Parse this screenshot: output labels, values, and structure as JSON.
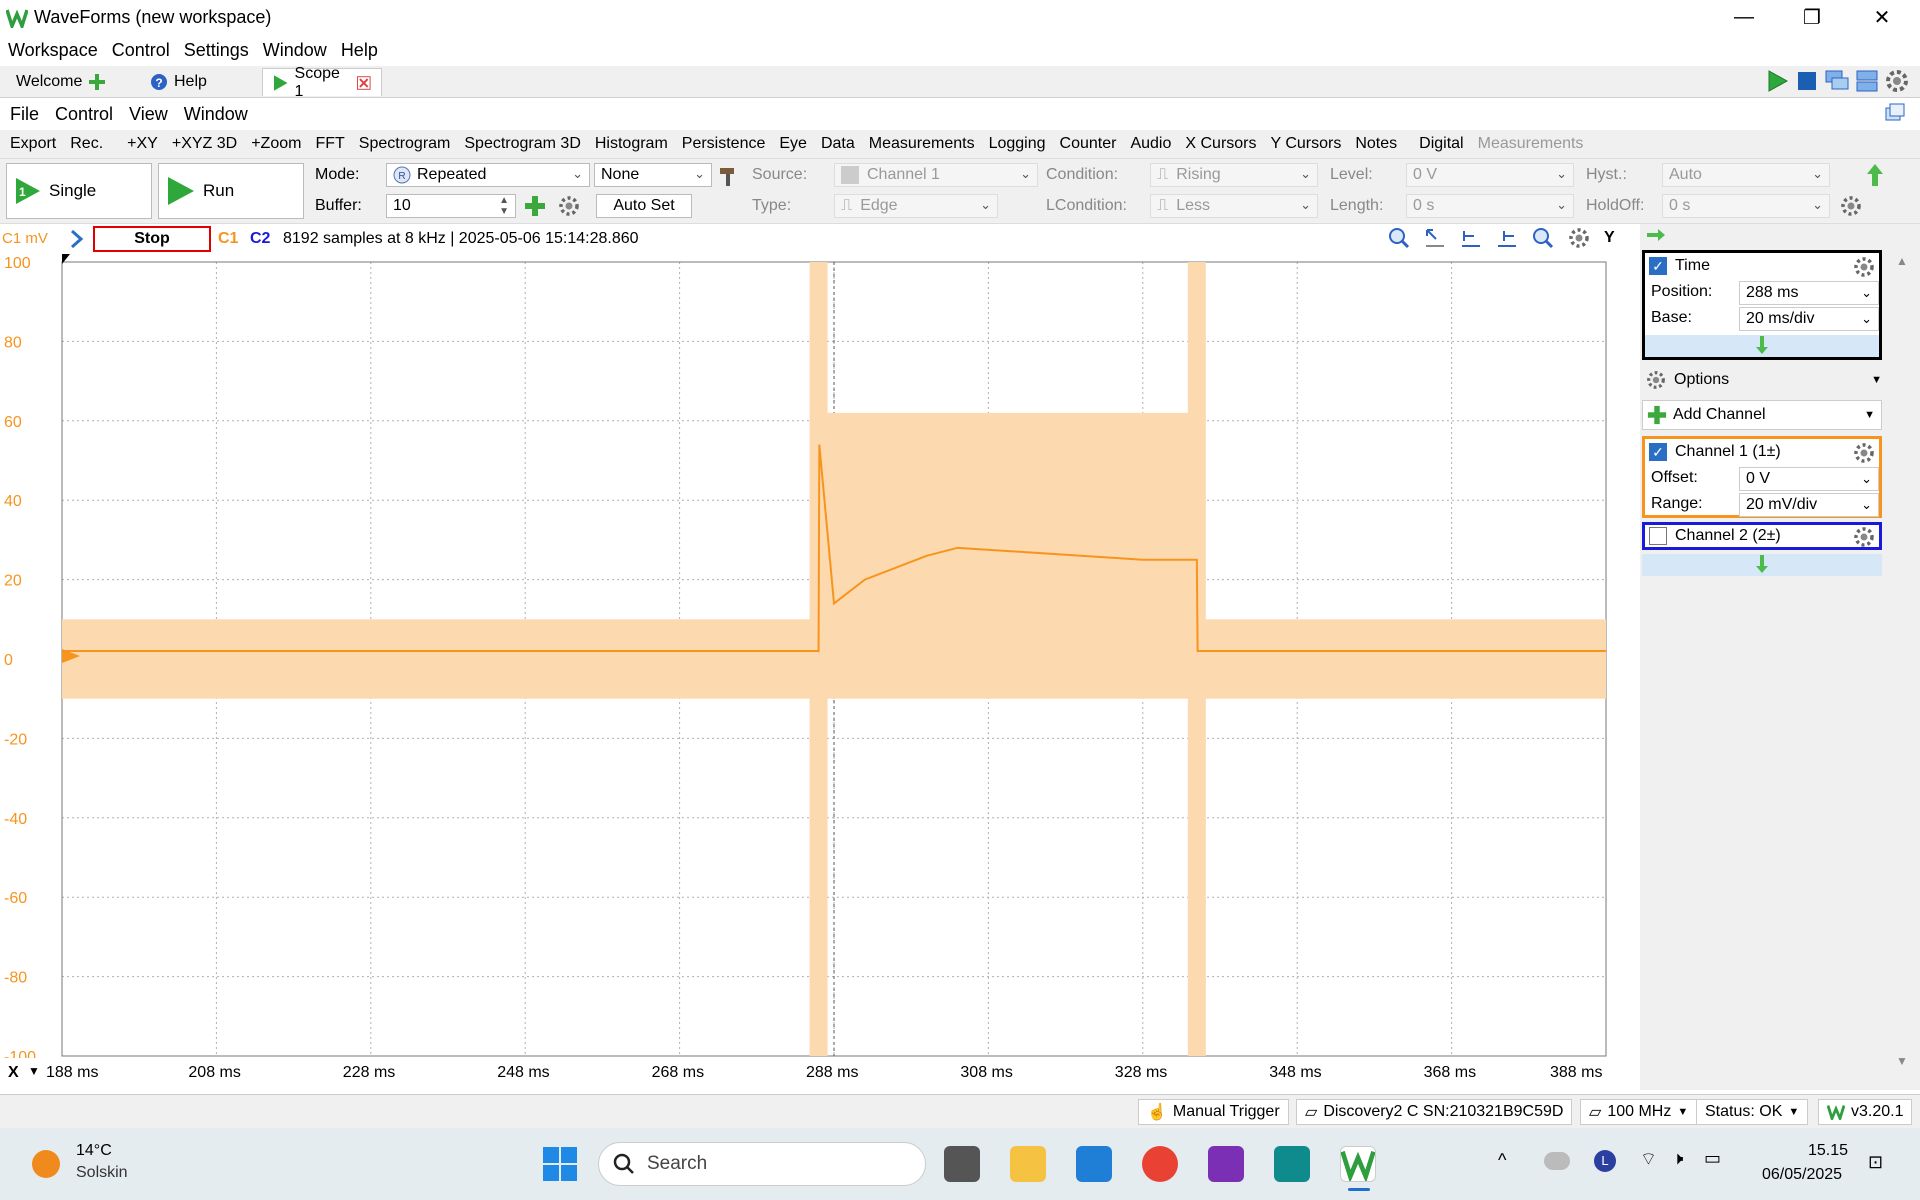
{
  "window": {
    "title": "WaveForms (new workspace)",
    "minimize": "—",
    "maximize": "❐",
    "close": "✕"
  },
  "menu": [
    "Workspace",
    "Control",
    "Settings",
    "Window",
    "Help"
  ],
  "tabs": {
    "welcome": "Welcome",
    "help": "Help",
    "scope": "Scope 1"
  },
  "menu2": [
    "File",
    "Control",
    "View",
    "Window"
  ],
  "toolbar": [
    "Export",
    "Rec.",
    "+XY",
    "+XYZ 3D",
    "+Zoom",
    "FFT",
    "Spectrogram",
    "Spectrogram 3D",
    "Histogram",
    "Persistence",
    "Eye",
    "Data",
    "Measurements",
    "Logging",
    "Counter",
    "Audio",
    "X Cursors",
    "Y Cursors",
    "Notes",
    "Digital",
    "Measurements"
  ],
  "control": {
    "single": "Single",
    "single_badge": "1",
    "run": "Run",
    "mode_label": "Mode:",
    "mode": "Repeated",
    "buffer_label": "Buffer:",
    "buffer": "10",
    "none": "None",
    "autoset": "Auto Set",
    "source_label": "Source:",
    "source": "Channel 1",
    "type_label": "Type:",
    "type": "Edge",
    "condition_label": "Condition:",
    "condition": "Rising",
    "lcondition_label": "LCondition:",
    "lcondition": "Less",
    "level_label": "Level:",
    "level": "0 V",
    "length_label": "Length:",
    "length": "0 s",
    "hyst_label": "Hyst.:",
    "hyst": "Auto",
    "holdoff_label": "HoldOff:",
    "holdoff": "0 s"
  },
  "plot_header": {
    "unit": "C1 mV",
    "stop": "Stop",
    "c1": "C1",
    "c2": "C2",
    "info": "8192 samples at 8 kHz | 2025-05-06 15:14:28.860",
    "y": "Y"
  },
  "x_axis_label": "X",
  "right_panel": {
    "time_title": "Time",
    "position_label": "Position:",
    "position": "288 ms",
    "base_label": "Base:",
    "base": "20 ms/div",
    "options": "Options",
    "add_channel": "Add Channel",
    "ch1_title": "Channel 1 (1±)",
    "offset_label": "Offset:",
    "offset": "0 V",
    "range_label": "Range:",
    "range": "20 mV/div",
    "ch2_title": "Channel 2 (2±)"
  },
  "status": {
    "manual_trigger": "Manual Trigger",
    "device": "Discovery2 C SN:210321B9C59D",
    "clock": "100 MHz",
    "status": "Status: OK",
    "version": "v3.20.1"
  },
  "taskbar": {
    "temp": "14°C",
    "weather": "Solskin",
    "search": "Search",
    "time": "15.15",
    "date": "06/05/2025"
  },
  "colors": {
    "ch1": "#f7941d",
    "ch1_envelope": "#fdd9b0",
    "ch2": "#1a1adb",
    "stop_border": "#e00000",
    "grid": "#b0b0b0"
  },
  "chart_data": {
    "type": "line",
    "title": "",
    "xlabel": "",
    "ylabel": "C1 mV",
    "x_ticks": [
      "188 ms",
      "208 ms",
      "228 ms",
      "248 ms",
      "268 ms",
      "288 ms",
      "308 ms",
      "328 ms",
      "348 ms",
      "368 ms",
      "388 ms"
    ],
    "y_ticks": [
      "100",
      "80",
      "60",
      "40",
      "20",
      "0",
      "-20",
      "-40",
      "-60",
      "-80",
      "-100"
    ],
    "xlim": [
      188,
      388
    ],
    "ylim": [
      -100,
      100
    ],
    "series": [
      {
        "x": [
          188,
          286,
          286.1,
          288,
          292,
          300,
          304,
          312,
          320,
          328,
          335,
          335.1,
          388
        ],
        "y": [
          2,
          2,
          54,
          14,
          20,
          26,
          28,
          27,
          26,
          25,
          25,
          2,
          2
        ]
      }
    ]
  }
}
